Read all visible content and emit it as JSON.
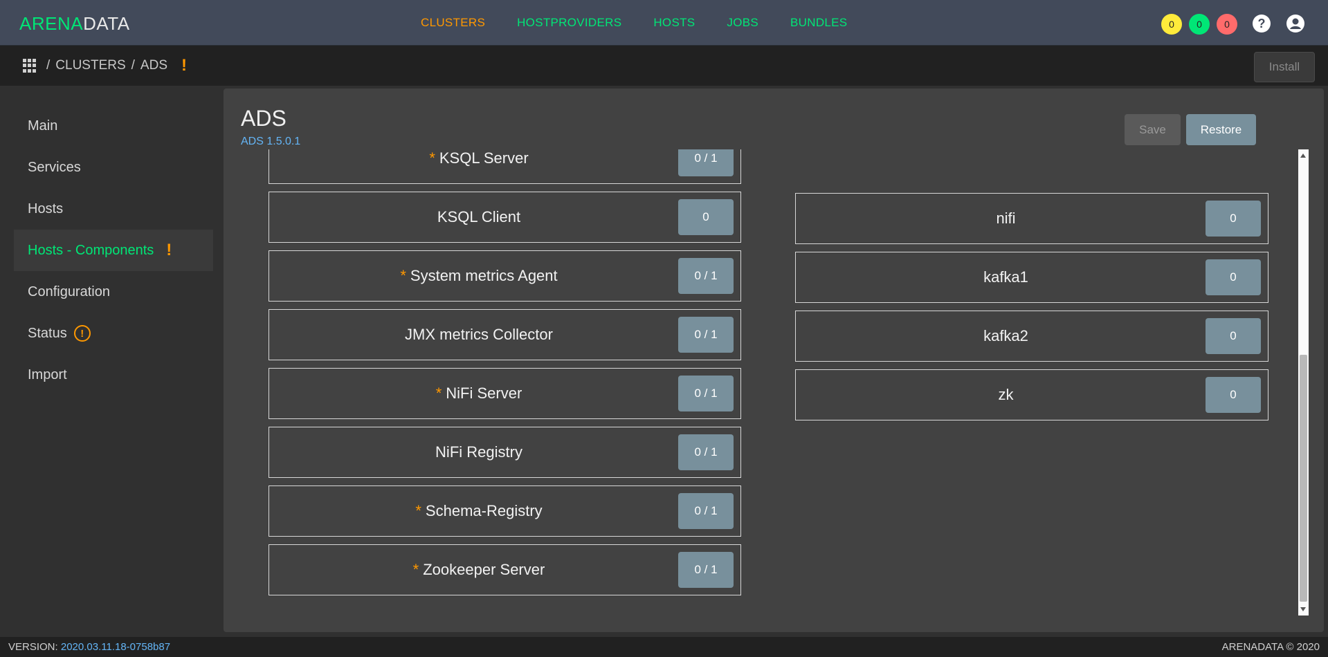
{
  "header": {
    "logo_part1": "ARENA",
    "logo_part2": "DATA",
    "nav": [
      {
        "label": "CLUSTERS"
      },
      {
        "label": "HOSTPROVIDERS"
      },
      {
        "label": "HOSTS"
      },
      {
        "label": "JOBS"
      },
      {
        "label": "BUNDLES"
      }
    ],
    "badges": {
      "yellow": "0",
      "green": "0",
      "red": "0"
    },
    "help_glyph": "?",
    "colors": {
      "accent_active": "#ff9800",
      "accent_link": "#00e676"
    }
  },
  "breadcrumb": {
    "items": [
      "CLUSTERS",
      "ADS"
    ],
    "separator": "/",
    "warning": "!",
    "install_label": "Install"
  },
  "sidebar": {
    "items": [
      {
        "label": "Main"
      },
      {
        "label": "Services"
      },
      {
        "label": "Hosts"
      },
      {
        "label": "Hosts - Components",
        "active": true,
        "warning": "!"
      },
      {
        "label": "Configuration"
      },
      {
        "label": "Status",
        "status_icon": "!"
      },
      {
        "label": "Import"
      }
    ]
  },
  "main": {
    "title": "ADS",
    "subtitle": "ADS 1.5.0.1",
    "save_label": "Save",
    "restore_label": "Restore",
    "required_mark": "*",
    "components": [
      {
        "name": "KSQL Server",
        "required": true,
        "count": "0 / 1"
      },
      {
        "name": "KSQL Client",
        "required": false,
        "count": "0"
      },
      {
        "name": "System metrics Agent",
        "required": true,
        "count": "0 / 1"
      },
      {
        "name": "JMX metrics Collector",
        "required": false,
        "count": "0 / 1"
      },
      {
        "name": "NiFi Server",
        "required": true,
        "count": "0 / 1"
      },
      {
        "name": "NiFi Registry",
        "required": false,
        "count": "0 / 1"
      },
      {
        "name": "Schema-Registry",
        "required": true,
        "count": "0 / 1"
      },
      {
        "name": "Zookeeper Server",
        "required": true,
        "count": "0 / 1"
      }
    ],
    "hosts": [
      {
        "name": "nifi",
        "count": "0"
      },
      {
        "name": "kafka1",
        "count": "0"
      },
      {
        "name": "kafka2",
        "count": "0"
      },
      {
        "name": "zk",
        "count": "0"
      }
    ]
  },
  "footer": {
    "version_label": "VERSION: ",
    "version": "2020.03.11.18-0758b87",
    "copyright": "ARENADATA © 2020"
  }
}
